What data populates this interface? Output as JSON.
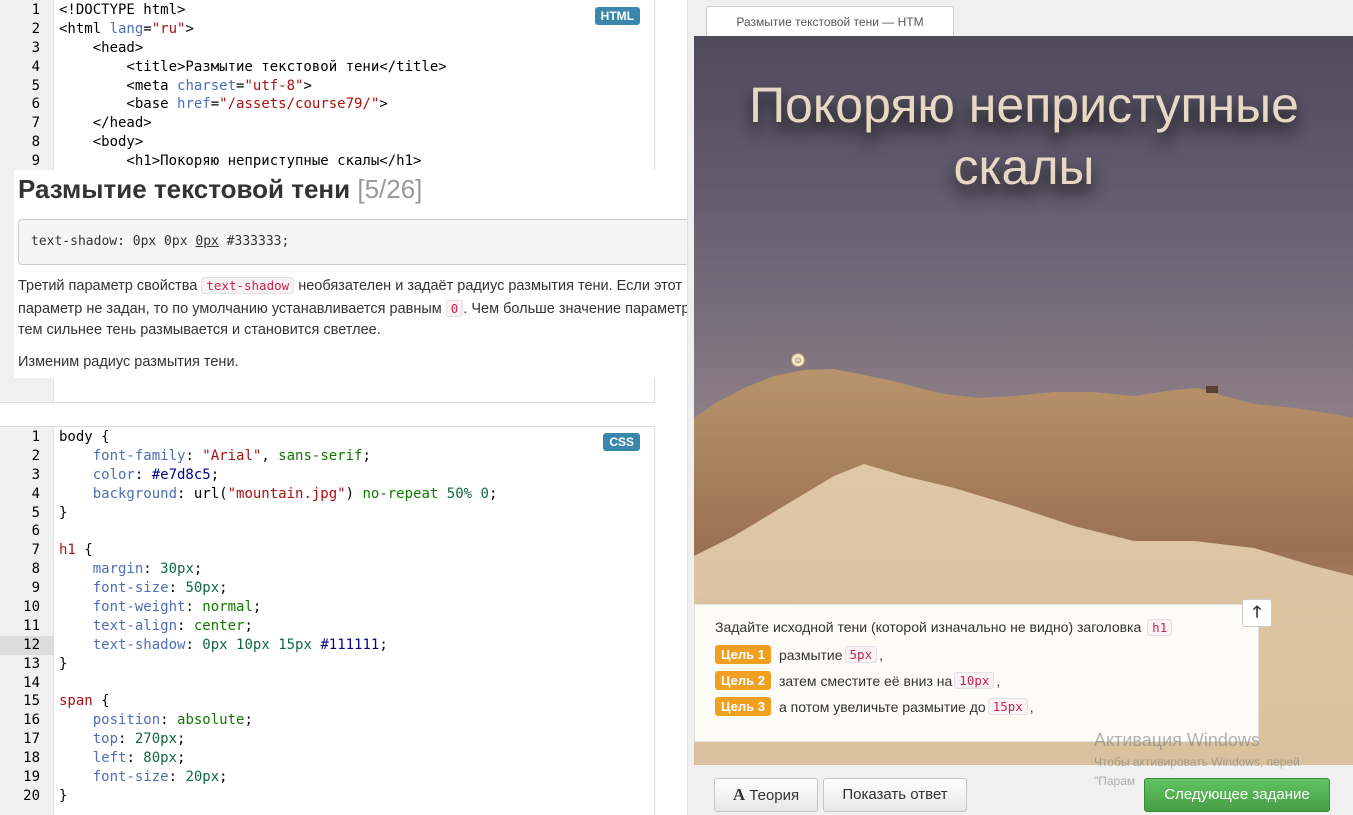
{
  "html_editor": {
    "badge": "HTML",
    "lines": [
      {
        "n": "1",
        "segs": [
          [
            "t-ptag",
            "<!DOCTYPE html>"
          ]
        ]
      },
      {
        "n": "2",
        "segs": [
          [
            "t-ptag",
            "<html "
          ],
          [
            "t-prop",
            "lang"
          ],
          [
            "t-ptag",
            "="
          ],
          [
            "t-str",
            "\"ru\""
          ],
          [
            "t-ptag",
            ">"
          ]
        ]
      },
      {
        "n": "3",
        "segs": [
          [
            "t-ptag",
            "    <head>"
          ]
        ]
      },
      {
        "n": "4",
        "segs": [
          [
            "t-ptag",
            "        <title>Размытие текстовой тени</title>"
          ]
        ]
      },
      {
        "n": "5",
        "segs": [
          [
            "t-ptag",
            "        <meta "
          ],
          [
            "t-prop",
            "charset"
          ],
          [
            "t-ptag",
            "="
          ],
          [
            "t-str",
            "\"utf-8\""
          ],
          [
            "t-ptag",
            ">"
          ]
        ]
      },
      {
        "n": "6",
        "segs": [
          [
            "t-ptag",
            "        <base "
          ],
          [
            "t-prop",
            "href"
          ],
          [
            "t-ptag",
            "="
          ],
          [
            "t-str",
            "\"/assets/course79/\""
          ],
          [
            "t-ptag",
            ">"
          ]
        ]
      },
      {
        "n": "7",
        "segs": [
          [
            "t-ptag",
            "    </head>"
          ]
        ]
      },
      {
        "n": "8",
        "segs": [
          [
            "t-ptag",
            "    <body>"
          ]
        ]
      },
      {
        "n": "9",
        "segs": [
          [
            "t-ptag",
            "        <h1>Покоряю неприступные скалы</h1>"
          ]
        ]
      }
    ]
  },
  "theory": {
    "title": "Размытие текстовой тени",
    "progress": "[5/26]",
    "code_pre": "text-shadow: 0px 0px ",
    "code_u": "0px",
    "code_post": " #333333;",
    "p1_a": "Третий параметр свойства ",
    "p1_code1": "text-shadow",
    "p1_b": " необязателен и задаёт радиус размытия тени. Если этот параметр не задан, то по умолчанию устанавливается равным ",
    "p1_code2": "0",
    "p1_c": ". Чем больше значение параметра, тем сильнее тень размывается и становится светлее.",
    "p2": "Изменим радиус размытия тени."
  },
  "css_editor": {
    "badge": "CSS",
    "active_line": "12",
    "lines": [
      {
        "n": "1",
        "segs": [
          [
            "t-ptag",
            "body {"
          ]
        ]
      },
      {
        "n": "2",
        "segs": [
          [
            "t-prop",
            "    font-family"
          ],
          [
            "t-ptag",
            ": "
          ],
          [
            "t-str",
            "\"Arial\""
          ],
          [
            "t-ptag",
            ", "
          ],
          [
            "t-val",
            "sans-serif"
          ],
          [
            "t-ptag",
            ";"
          ]
        ]
      },
      {
        "n": "3",
        "segs": [
          [
            "t-prop",
            "    color"
          ],
          [
            "t-ptag",
            ": "
          ],
          [
            "t-kw",
            "#e7d8c5"
          ],
          [
            "t-ptag",
            ";"
          ]
        ]
      },
      {
        "n": "4",
        "segs": [
          [
            "t-prop",
            "    background"
          ],
          [
            "t-ptag",
            ": url("
          ],
          [
            "t-str",
            "\"mountain.jpg\""
          ],
          [
            "t-ptag",
            ") "
          ],
          [
            "t-val",
            "no-repeat"
          ],
          [
            "t-ptag",
            " "
          ],
          [
            "t-num",
            "50%"
          ],
          [
            "t-ptag",
            " "
          ],
          [
            "t-num",
            "0"
          ],
          [
            "t-ptag",
            ";"
          ]
        ]
      },
      {
        "n": "5",
        "segs": [
          [
            "t-ptag",
            "}"
          ]
        ]
      },
      {
        "n": "6",
        "segs": [
          [
            "t-ptag",
            ""
          ]
        ]
      },
      {
        "n": "7",
        "segs": [
          [
            "t-sel",
            "h1"
          ],
          [
            "t-ptag",
            " {"
          ]
        ]
      },
      {
        "n": "8",
        "segs": [
          [
            "t-prop",
            "    margin"
          ],
          [
            "t-ptag",
            ": "
          ],
          [
            "t-num",
            "30px"
          ],
          [
            "t-ptag",
            ";"
          ]
        ]
      },
      {
        "n": "9",
        "segs": [
          [
            "t-prop",
            "    font-size"
          ],
          [
            "t-ptag",
            ": "
          ],
          [
            "t-num",
            "50px"
          ],
          [
            "t-ptag",
            ";"
          ]
        ]
      },
      {
        "n": "10",
        "segs": [
          [
            "t-prop",
            "    font-weight"
          ],
          [
            "t-ptag",
            ": "
          ],
          [
            "t-val",
            "normal"
          ],
          [
            "t-ptag",
            ";"
          ]
        ]
      },
      {
        "n": "11",
        "segs": [
          [
            "t-prop",
            "    text-align"
          ],
          [
            "t-ptag",
            ": "
          ],
          [
            "t-val",
            "center"
          ],
          [
            "t-ptag",
            ";"
          ]
        ]
      },
      {
        "n": "12",
        "segs": [
          [
            "t-prop",
            "    text-shadow"
          ],
          [
            "t-ptag",
            ": "
          ],
          [
            "t-num",
            "0px"
          ],
          [
            "t-ptag",
            " "
          ],
          [
            "t-num",
            "10px"
          ],
          [
            "t-ptag",
            " "
          ],
          [
            "t-num",
            "15px"
          ],
          [
            "t-ptag",
            " "
          ],
          [
            "t-kw",
            "#111111"
          ],
          [
            "t-ptag",
            ";"
          ]
        ]
      },
      {
        "n": "13",
        "segs": [
          [
            "t-ptag",
            "}"
          ]
        ]
      },
      {
        "n": "14",
        "segs": [
          [
            "t-ptag",
            ""
          ]
        ]
      },
      {
        "n": "15",
        "segs": [
          [
            "t-sel",
            "span"
          ],
          [
            "t-ptag",
            " {"
          ]
        ]
      },
      {
        "n": "16",
        "segs": [
          [
            "t-prop",
            "    position"
          ],
          [
            "t-ptag",
            ": "
          ],
          [
            "t-val",
            "absolute"
          ],
          [
            "t-ptag",
            ";"
          ]
        ]
      },
      {
        "n": "17",
        "segs": [
          [
            "t-prop",
            "    top"
          ],
          [
            "t-ptag",
            ": "
          ],
          [
            "t-num",
            "270px"
          ],
          [
            "t-ptag",
            ";"
          ]
        ]
      },
      {
        "n": "18",
        "segs": [
          [
            "t-prop",
            "    left"
          ],
          [
            "t-ptag",
            ": "
          ],
          [
            "t-num",
            "80px"
          ],
          [
            "t-ptag",
            ";"
          ]
        ]
      },
      {
        "n": "19",
        "segs": [
          [
            "t-prop",
            "    font-size"
          ],
          [
            "t-ptag",
            ": "
          ],
          [
            "t-num",
            "20px"
          ],
          [
            "t-ptag",
            ";"
          ]
        ]
      },
      {
        "n": "20",
        "segs": [
          [
            "t-ptag",
            "}"
          ]
        ]
      }
    ]
  },
  "preview": {
    "tab_title": "Размытие текстовой тени — HTM",
    "heading": "Покоряю неприступные скалы",
    "smiley_icon": "smiley-icon"
  },
  "task": {
    "intro": "Задайте исходной тени (которой изначально не видно) заголовка ",
    "intro_code": "h1",
    "goals": [
      {
        "label": "Цель 1",
        "text": "размытие ",
        "code": "5px",
        "tail": ","
      },
      {
        "label": "Цель 2",
        "text": "затем сместите её вниз на ",
        "code": "10px",
        "tail": ","
      },
      {
        "label": "Цель 3",
        "text": "а потом увеличьте размытие до ",
        "code": "15px",
        "tail": ","
      }
    ],
    "up_icon": "arrow-up-icon"
  },
  "buttons": {
    "theory_icon": "A",
    "theory": "Теория",
    "show_answer": "Показать ответ",
    "next": "Следующее задание"
  },
  "watermark": {
    "line1": "Активация Windows",
    "line2": "Чтобы активировать Windows, перей",
    "line3": "\"Парам"
  },
  "colors": {
    "heading_color": "#e7d8c5",
    "badge_blue": "#3a87ad",
    "goal_orange": "#f0a020",
    "next_green": "#5cb85c"
  }
}
